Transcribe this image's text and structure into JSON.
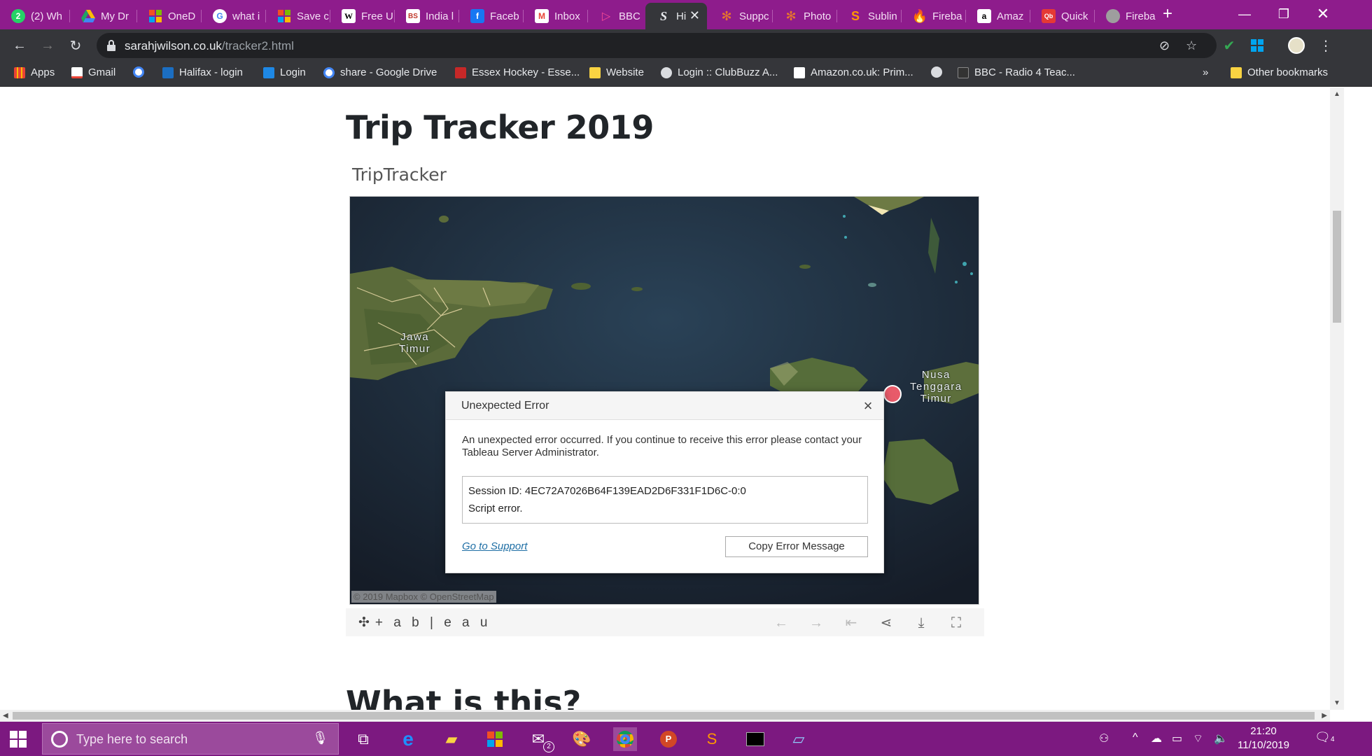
{
  "browser": {
    "tabs": [
      {
        "label": "(2) Wh",
        "icon": "whatsapp-icon",
        "color": "#25d366"
      },
      {
        "label": "My Dr",
        "icon": "google-drive-icon",
        "color": "#fbbc04"
      },
      {
        "label": "OneD",
        "icon": "microsoft-icon",
        "color": "#f25022"
      },
      {
        "label": "what i",
        "icon": "google-icon",
        "color": "#4285f4"
      },
      {
        "label": "Save c",
        "icon": "microsoft-icon",
        "color": "#f25022"
      },
      {
        "label": "Free U",
        "icon": "wikipedia-icon",
        "color": "#ffffff"
      },
      {
        "label": "India l",
        "icon": "bs-icon",
        "color": "#c0392b"
      },
      {
        "label": "Faceb",
        "icon": "facebook-icon",
        "color": "#1877f2"
      },
      {
        "label": "Inbox",
        "icon": "gmail-icon",
        "color": "#ea4335"
      },
      {
        "label": "BBC iI",
        "icon": "bbc-iplayer-icon",
        "color": "#f54997"
      },
      {
        "label": "Hi",
        "icon": "tab-s-icon",
        "color": "#e8eaed",
        "active": true
      },
      {
        "label": "Suppc",
        "icon": "tableau-icon",
        "color": "#e8762c"
      },
      {
        "label": "Photo",
        "icon": "tableau-icon",
        "color": "#e8762c"
      },
      {
        "label": "Sublin",
        "icon": "sublime-icon",
        "color": "#ff9800"
      },
      {
        "label": "Fireba",
        "icon": "firebase-icon",
        "color": "#ffca28"
      },
      {
        "label": "Amaz",
        "icon": "amazon-icon",
        "color": "#ffffff"
      },
      {
        "label": "Quick",
        "icon": "quickbooks-icon",
        "color": "#e53935"
      },
      {
        "label": "Fireba",
        "icon": "globe-icon",
        "color": "#9e9e9e"
      }
    ],
    "url_domain": "sarahjwilson.co.uk",
    "url_path": "/tracker2.html",
    "bookmarks": [
      {
        "label": "Apps",
        "icon": "apps-grid-icon",
        "color": "#ea4335"
      },
      {
        "label": "Gmail",
        "icon": "gmail-icon",
        "color": "#ea4335"
      },
      {
        "label": "",
        "icon": "google-icon",
        "color": "#4285f4"
      },
      {
        "label": "Halifax - login",
        "icon": "halifax-icon",
        "color": "#1b6ec2"
      },
      {
        "label": "Login",
        "icon": "bank-icon",
        "color": "#1e88e5"
      },
      {
        "label": "share - Google Drive",
        "icon": "google-icon",
        "color": "#4285f4"
      },
      {
        "label": "Essex Hockey - Esse...",
        "icon": "hockey-icon",
        "color": "#c62828"
      },
      {
        "label": "Website",
        "icon": "folder-icon",
        "color": "#f9d342"
      },
      {
        "label": "Login :: ClubBuzz A...",
        "icon": "globe-icon",
        "color": "#dadce0"
      },
      {
        "label": "Amazon.co.uk: Prim...",
        "icon": "amazon-icon",
        "color": "#ffffff"
      },
      {
        "label": "",
        "icon": "globe-icon",
        "color": "#dadce0"
      },
      {
        "label": "BBC - Radio 4 Teac...",
        "icon": "bbc-icon",
        "color": "#333333"
      }
    ],
    "bookmarks_overflow": "»",
    "other_bookmarks": "Other bookmarks"
  },
  "page": {
    "title": "Trip Tracker 2019",
    "viz_name": "TripTracker",
    "map_labels": {
      "region1": "Jawa\nTimur",
      "region2": "Nusa\nTenggara\nTimur"
    },
    "attribution": "© 2019 Mapbox  © OpenStreetMap",
    "tableau_logo": "+ a b | e a u",
    "next_heading": "What is this?"
  },
  "dialog": {
    "title": "Unexpected Error",
    "message": "An unexpected error occurred. If you continue to receive this error please contact your Tableau Server Administrator.",
    "session_line": "Session ID: 4EC72A7026B64F139EAD2D6F331F1D6C-0:0",
    "error_line": "Script error.",
    "support_link": "Go to Support",
    "copy_button": "Copy Error Message"
  },
  "taskbar": {
    "search_placeholder": "Type here to search",
    "mail_badge": "2",
    "time": "21:20",
    "date": "11/10/2019",
    "notification_count": "4"
  },
  "colors": {
    "tabstrip": "#8e1c8c",
    "toolbar": "#35363a",
    "taskbar": "#7c1980",
    "link": "#1f6fa5"
  }
}
